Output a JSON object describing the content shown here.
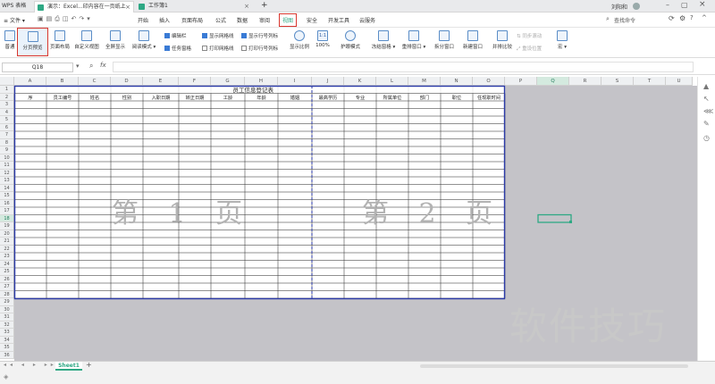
{
  "titlebar": {
    "tabs": [
      {
        "label": "WPS 表格",
        "active": false
      },
      {
        "label": "演示：Excel...印内容在一页纸上",
        "active": true
      },
      {
        "label": "工作簿1",
        "active": false
      }
    ],
    "user": "刘阳和"
  },
  "menubar": {
    "file_label": "文件",
    "items": [
      "开始",
      "插入",
      "页面布局",
      "公式",
      "数据",
      "审阅",
      "视图",
      "安全",
      "开发工具",
      "云服务"
    ],
    "active_item": "视图",
    "search_placeholder": "查找命令"
  },
  "ribbon": {
    "buttons": [
      {
        "label": "普通"
      },
      {
        "label": "分页预览",
        "active": true
      },
      {
        "label": "页面布局"
      },
      {
        "label": "自定义视图"
      },
      {
        "label": "全屏显示"
      },
      {
        "label": "阅读模式"
      },
      {
        "label": "显示比例"
      },
      {
        "label": "100%"
      },
      {
        "label": "护眼模式"
      },
      {
        "label": "冻结窗格"
      },
      {
        "label": "重排窗口"
      },
      {
        "label": "拆分窗口"
      },
      {
        "label": "新建窗口"
      },
      {
        "label": "并排比较"
      },
      {
        "label": "宏"
      }
    ],
    "checks": [
      {
        "label": "编辑栏",
        "checked": true
      },
      {
        "label": "显示网格线",
        "checked": true
      },
      {
        "label": "显示行号列标",
        "checked": true
      },
      {
        "label": "任务窗格",
        "checked": true
      },
      {
        "label": "打印网格线",
        "checked": false
      },
      {
        "label": "打印行号列标",
        "checked": false
      }
    ],
    "sync_scroll": "同步滚动",
    "reset_position": "重设位置"
  },
  "formulabar": {
    "namebox": "Q18",
    "fx": "fx"
  },
  "sheet": {
    "columns": [
      "A",
      "B",
      "C",
      "D",
      "E",
      "F",
      "G",
      "H",
      "I",
      "J",
      "K",
      "L",
      "M",
      "N",
      "O",
      "P",
      "Q",
      "R",
      "S",
      "T",
      "U"
    ],
    "selected_column": "Q",
    "selected_row": "18",
    "title": "员工信息登记表",
    "headers": [
      "序",
      "员工编号",
      "姓名",
      "性别",
      "入职日期",
      "转正日期",
      "工龄",
      "年龄",
      "婚姻",
      "最高学历",
      "专业",
      "所属单位",
      "部门",
      "职位",
      "任现职时间"
    ],
    "row_count": 30,
    "page1_label": "第 1 页",
    "page2_label": "第 2 页"
  },
  "sheetbar": {
    "sheet_name": "Sheet1",
    "add": "+"
  },
  "watermark": "软件技巧",
  "colors": {
    "accent": "#2ea884",
    "page_border": "#2b3aa8",
    "highlight": "#d9372f",
    "gray_area": "#c4c3c8"
  }
}
